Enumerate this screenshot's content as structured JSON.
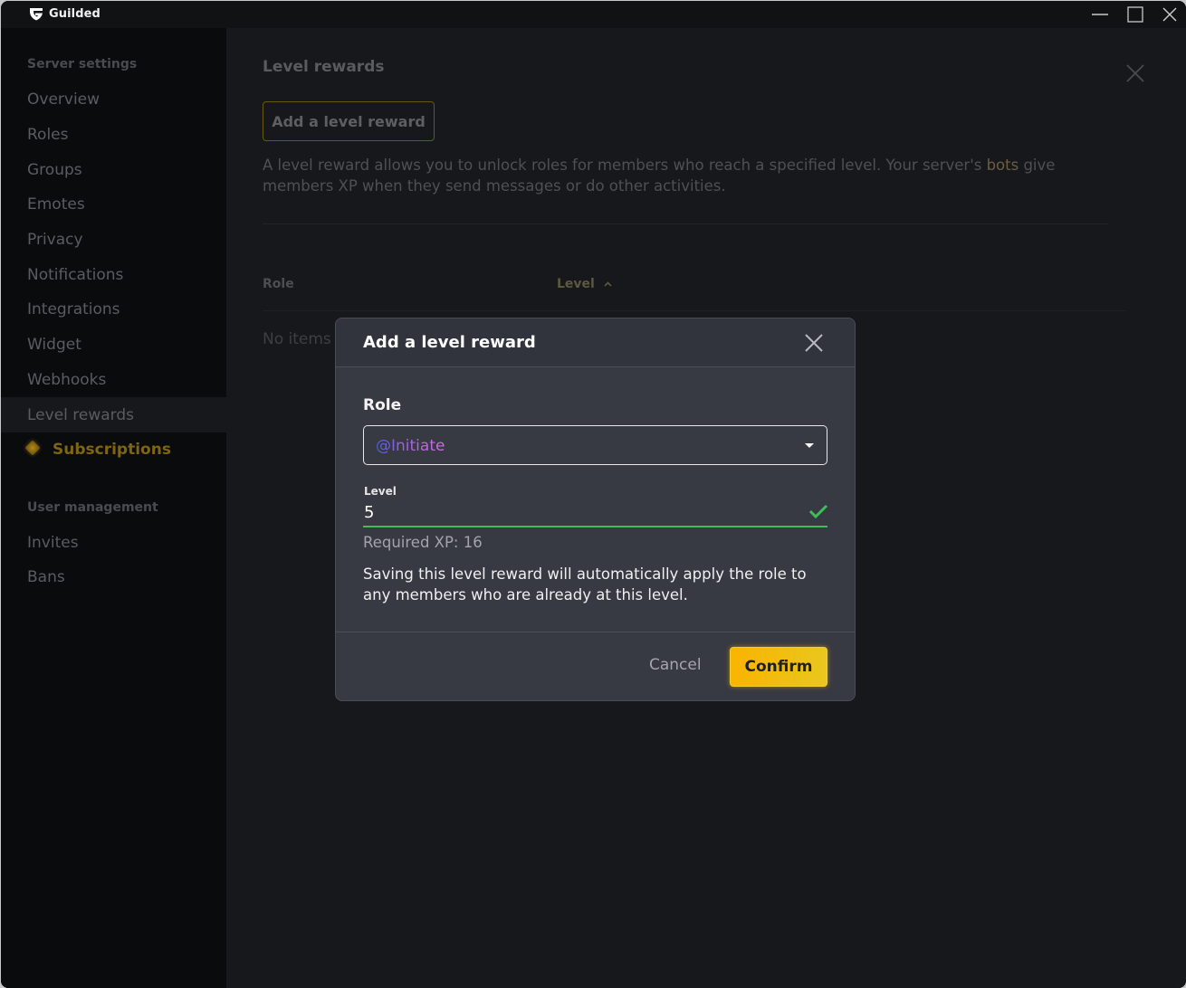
{
  "titlebar": {
    "app_name": "Guilded",
    "logo_icon": "guilded-logo-icon",
    "controls": [
      "minimize-icon",
      "maximize-icon",
      "close-icon"
    ]
  },
  "sidebar": {
    "section1_heading": "Server settings",
    "section1_items": [
      {
        "label": "Overview"
      },
      {
        "label": "Roles"
      },
      {
        "label": "Groups"
      },
      {
        "label": "Emotes"
      },
      {
        "label": "Privacy"
      },
      {
        "label": "Notifications"
      },
      {
        "label": "Integrations"
      },
      {
        "label": "Widget"
      },
      {
        "label": "Webhooks"
      },
      {
        "label": "Level rewards",
        "active": true
      },
      {
        "label": "Subscriptions",
        "icon": "diamond-icon",
        "premium": true
      }
    ],
    "section2_heading": "User management",
    "section2_items": [
      {
        "label": "Invites"
      },
      {
        "label": "Bans"
      }
    ]
  },
  "main": {
    "title": "Level rewards",
    "add_button_label": "Add a level reward",
    "description_part1": "A level reward allows you to unlock roles for members who reach a specified level. Your server's ",
    "description_link": "bots",
    "description_part2": " give members XP when they send messages or do other activities.",
    "table": {
      "columns": [
        "Role",
        "Level"
      ],
      "sort_column": "Level",
      "sort_direction": "ascending",
      "empty_text": "No items"
    }
  },
  "modal": {
    "title": "Add a level reward",
    "role_label": "Role",
    "role_value": "@Initiate",
    "level_label": "Level",
    "level_value": "5",
    "level_valid": true,
    "required_xp_text": "Required XP: 16",
    "note": "Saving this level reward will automatically apply the role to any members who are already at this level.",
    "cancel_label": "Cancel",
    "confirm_label": "Confirm"
  },
  "colors": {
    "accent": "#f5c400",
    "valid": "#3dbf58",
    "role_gradient_start": "#4c5fe0",
    "role_gradient_end": "#d06ee0"
  }
}
